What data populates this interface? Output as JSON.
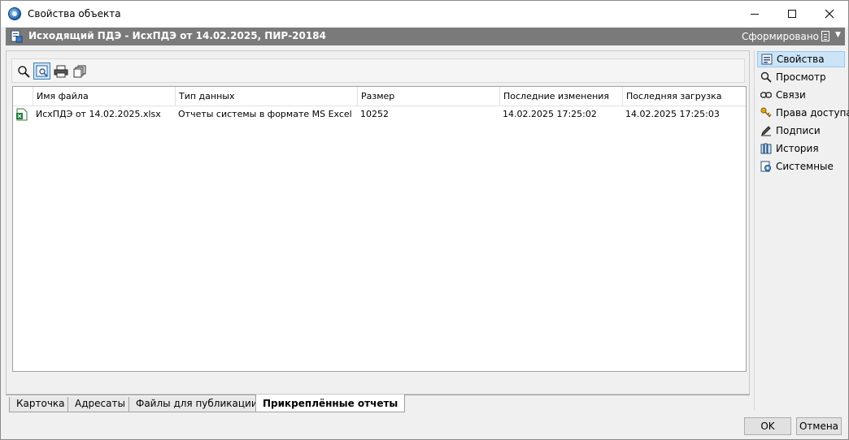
{
  "window": {
    "title": "Свойства объекта"
  },
  "object_bar": {
    "title": "Исходящий ПДЭ - ИсхПДЭ от 14.02.2025, ПИР-20184",
    "status": "Сформировано",
    "caret": "▼"
  },
  "toolbar": {
    "buttons": [
      {
        "icon": "search-icon"
      },
      {
        "icon": "preview-icon"
      },
      {
        "icon": "print-icon"
      },
      {
        "icon": "copies-icon"
      }
    ]
  },
  "table": {
    "columns": [
      "Имя файла",
      "Тип данных",
      "Размер",
      "Последние изменения",
      "Последняя загрузка"
    ],
    "rows": [
      {
        "icon": "excel-file-icon",
        "file_name": "ИсхПДЭ от 14.02.2025.xlsx",
        "data_type": "Отчеты системы в формате MS Excel",
        "size": "10252",
        "modified": "14.02.2025 17:25:02",
        "uploaded": "14.02.2025 17:25:03"
      }
    ]
  },
  "tabs": [
    {
      "label": "Карточка"
    },
    {
      "label": "Адресаты"
    },
    {
      "label": "Файлы для публикации"
    },
    {
      "label": "Прикреплённые отчеты",
      "selected": true
    }
  ],
  "sidebar": {
    "items": [
      {
        "label": "Свойства",
        "icon": "properties-icon",
        "selected": true
      },
      {
        "label": "Просмотр",
        "icon": "search-icon"
      },
      {
        "label": "Связи",
        "icon": "link-icon"
      },
      {
        "label": "Права доступа",
        "icon": "keys-icon"
      },
      {
        "label": "Подписи",
        "icon": "pen-icon"
      },
      {
        "label": "История",
        "icon": "history-icon"
      },
      {
        "label": "Системные",
        "icon": "system-icon"
      }
    ]
  },
  "footer": {
    "ok": "OK",
    "cancel": "Отмена"
  },
  "colors": {
    "header_bar": "#7a7a7a",
    "selection": "#cce4f7",
    "selection_border": "#99c9ef"
  }
}
